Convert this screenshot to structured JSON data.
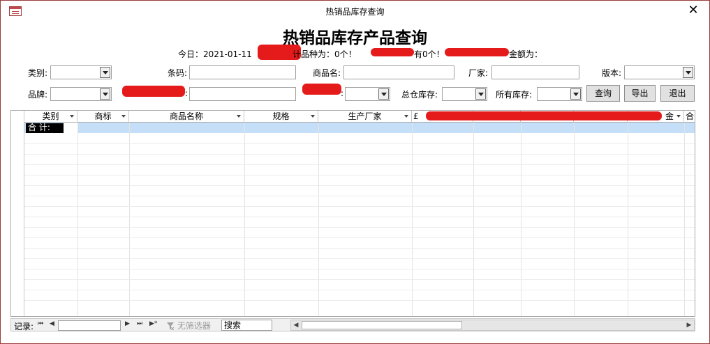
{
  "window": {
    "title": "热销品库存查询",
    "close_glyph": "✕"
  },
  "form": {
    "title": "热销品库存产品查询",
    "stats": {
      "today_label": "今日：2021-01-11",
      "frag_varieties": "计品种为：0个！",
      "frag_have": "有0个！",
      "frag_amount": "金额为："
    }
  },
  "filters": {
    "category_label": "类别:",
    "barcode_label": "条码:",
    "product_name_label": "商品名:",
    "maker_label": "厂家:",
    "version_label": "版本:",
    "brand_label": "品牌:",
    "colon": ":",
    "hq_stock_label": "总仓库存:",
    "all_stock_label": "所有库存:"
  },
  "buttons": {
    "query": "查询",
    "export": "导出",
    "exit": "退出"
  },
  "datasheet": {
    "columns": [
      "类别",
      "商标",
      "商品名称",
      "规格",
      "生产厂家",
      "£",
      "金",
      "合"
    ],
    "total_label": "合  计:"
  },
  "navigation": {
    "record_label": "记录:",
    "first": "⏮",
    "prev": "◀",
    "next": "▶",
    "last": "⏭",
    "new": "▶*",
    "filter_label": "无筛选器",
    "filter_icon": "funnel-icon",
    "search_placeholder": "搜索"
  },
  "colors": {
    "redaction": "#e51b1b",
    "row_highlight": "#c5dff8",
    "border": "#9a3a3a"
  }
}
